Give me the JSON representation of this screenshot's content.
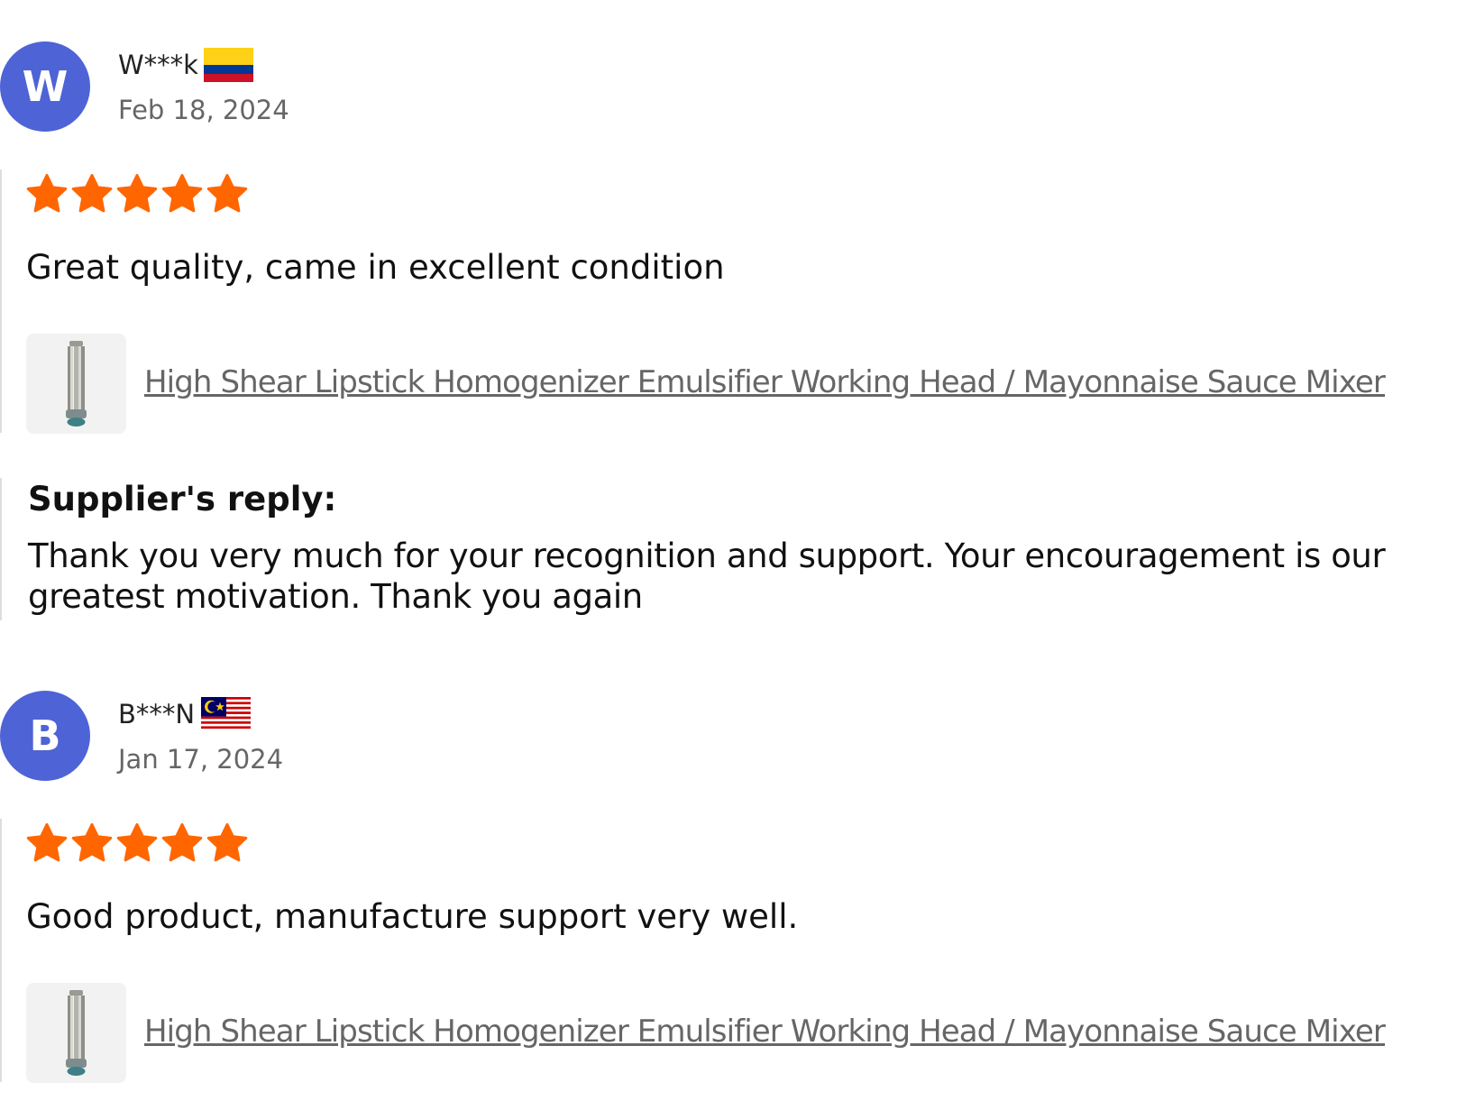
{
  "colors": {
    "avatar_bg": "#4e63d5",
    "star": "#ff6600",
    "link": "#666666",
    "divider": "#dddddd"
  },
  "reviews": [
    {
      "avatar_letter": "W",
      "name": "W***k",
      "flag": "colombia-flag-icon",
      "date": "Feb 18, 2024",
      "rating": 5,
      "text": "Great quality, came in excellent condition",
      "product_title": "High Shear Lipstick Homogenizer Emulsifier Working Head / Mayonnaise Sauce Mixer",
      "supplier_reply": {
        "heading": "Supplier's reply:",
        "text": "Thank you very much for your recognition and support. Your encouragement is our greatest motivation. Thank you again"
      }
    },
    {
      "avatar_letter": "B",
      "name": "B***N",
      "flag": "malaysia-flag-icon",
      "date": "Jan 17, 2024",
      "rating": 5,
      "text": "Good product, manufacture support very well.",
      "product_title": "High Shear Lipstick Homogenizer Emulsifier Working Head / Mayonnaise Sauce Mixer"
    }
  ]
}
